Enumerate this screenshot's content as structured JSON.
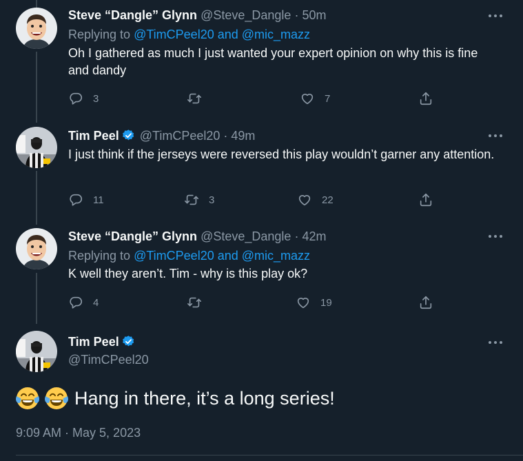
{
  "replies": [
    {
      "name": "Steve “Dangle” Glynn",
      "handle": "@Steve_Dangle",
      "sep": "·",
      "time": "50m",
      "replying_prefix": "Replying to",
      "replying_to": "@TimCPeel20 and @mic_mazz",
      "text": "Oh I gathered as much I just wanted your expert opinion on why this is fine and dandy",
      "replies_count": "3",
      "retweets_count": "",
      "likes_count": "7",
      "avatar": "steve-avatar"
    },
    {
      "name": "Tim Peel",
      "handle": "@TimCPeel20",
      "sep": "·",
      "time": "49m",
      "verified": true,
      "text": "I just think if the jerseys were reversed this play wouldn’t garner any attention.",
      "replies_count": "11",
      "retweets_count": "3",
      "likes_count": "22",
      "avatar": "referee-avatar"
    },
    {
      "name": "Steve “Dangle” Glynn",
      "handle": "@Steve_Dangle",
      "sep": "·",
      "time": "42m",
      "replying_prefix": "Replying to",
      "replying_to": "@TimCPeel20 and @mic_mazz",
      "text": "K well they aren’t. Tim - why is this play ok?",
      "replies_count": "4",
      "retweets_count": "",
      "likes_count": "19",
      "avatar": "steve-avatar"
    }
  ],
  "main_tweet": {
    "name": "Tim Peel",
    "handle": "@TimCPeel20",
    "verified": true,
    "text": "Hang in there, it’s a long series!",
    "emoji": [
      "face-with-tears-of-joy",
      "face-with-tears-of-joy"
    ],
    "timestamp": "9:09 AM · May 5, 2023"
  },
  "colors": {
    "background": "#15202b",
    "text": "#f7f9f9",
    "muted": "#8b98a5",
    "link": "#1d9bf0",
    "verified": "#1d9bf0"
  }
}
